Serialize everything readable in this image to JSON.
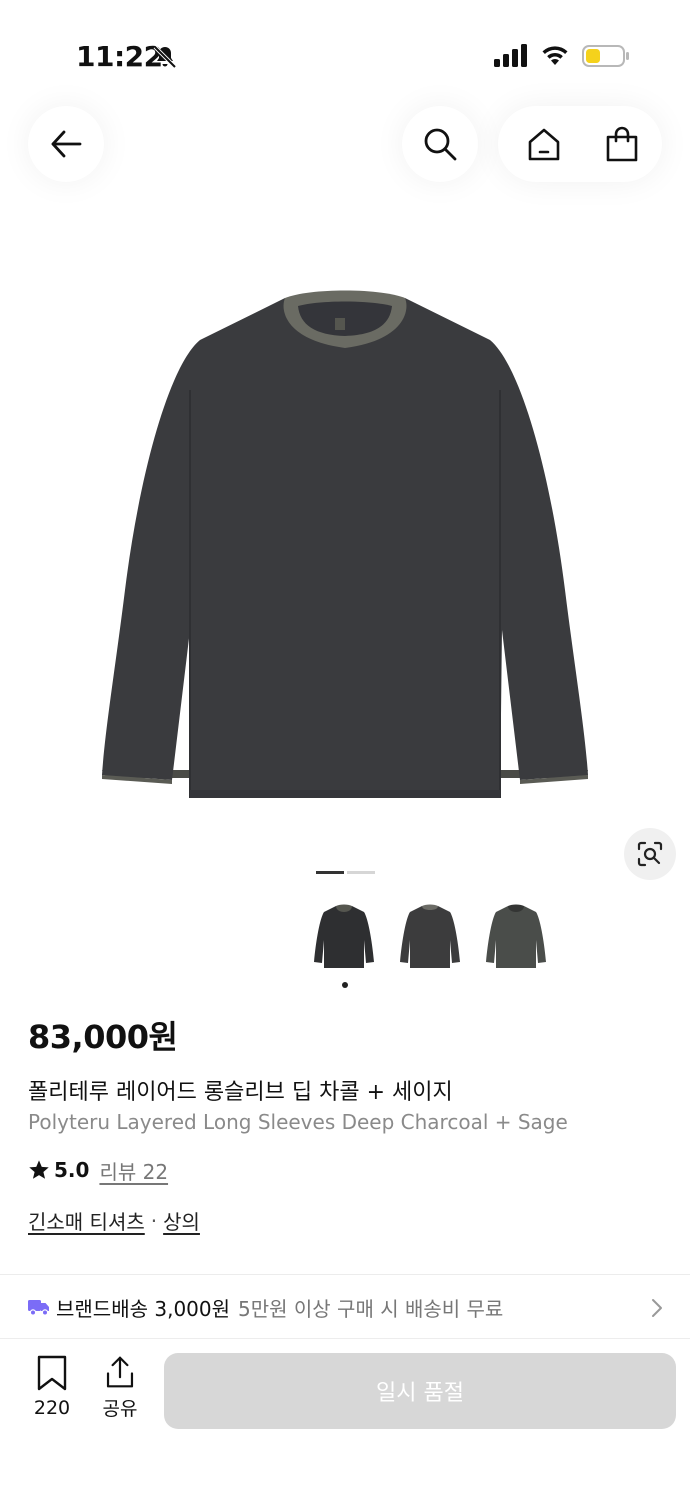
{
  "status_bar": {
    "time": "11:22"
  },
  "product": {
    "price": "83,000원",
    "title_ko": "폴리테루 레이어드 롱슬리브 딥 차콜 + 세이지",
    "title_en": "Polyteru Layered Long Sleeves Deep Charcoal + Sage",
    "rating": "5.0",
    "review_label": "리뷰 22",
    "category_main": "긴소매 티셔츠",
    "category_separator": "·",
    "category_parent": "상의",
    "thumbnails": [
      "charcoal-front",
      "charcoal-back",
      "sage-front"
    ],
    "image_pages": 2,
    "active_image_page": 1
  },
  "shipping": {
    "label": "브랜드배송 3,000원",
    "note": "5만원 이상 구매 시 배송비 무료"
  },
  "bottom_bar": {
    "bookmark_count": "220",
    "share_label": "공유",
    "buy_label": "일시 품절"
  },
  "colors": {
    "shirt": "#3a3b3e",
    "collar": "#6a6b63",
    "truck_icon": "#7b6cf6",
    "buy_disabled": "#d7d7d7",
    "battery_fill": "#f5d21c"
  },
  "icons": {
    "back": "arrow-left-icon",
    "search": "search-icon",
    "home": "home-icon",
    "cart": "shopping-bag-icon",
    "lens": "image-search-icon",
    "star": "star-icon",
    "truck": "truck-icon",
    "chevron": "chevron-right-icon",
    "bookmark": "bookmark-icon",
    "share": "share-icon"
  }
}
